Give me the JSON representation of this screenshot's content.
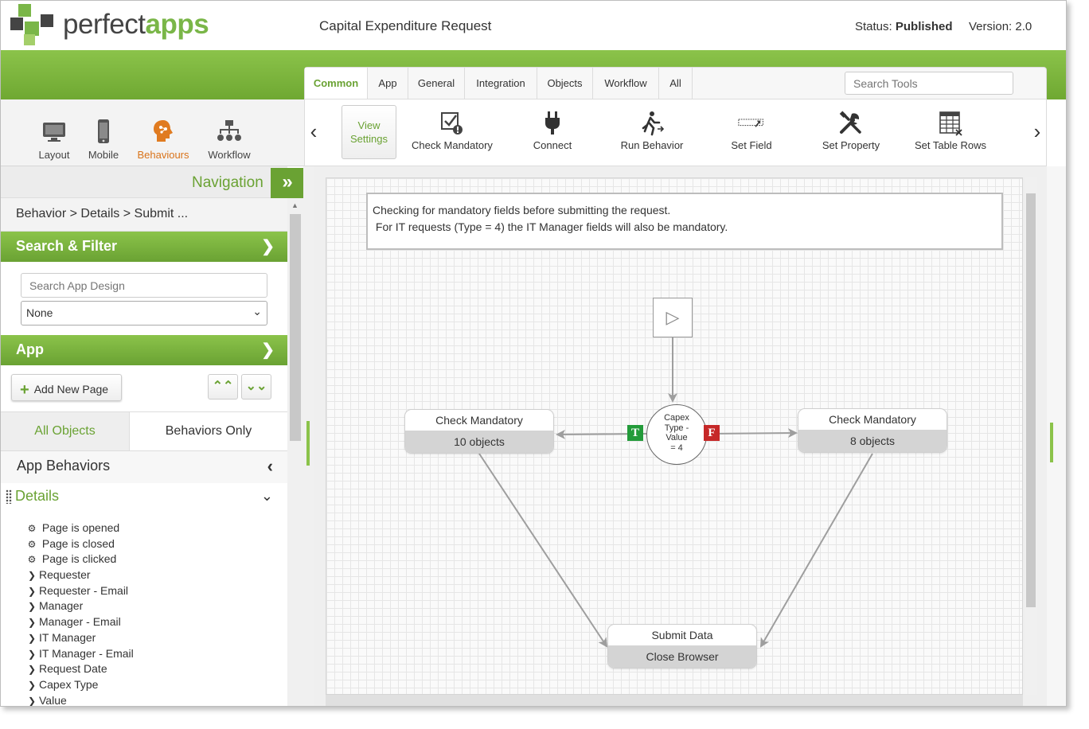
{
  "header": {
    "logo_word1": "perfect",
    "logo_word2": "apps",
    "app_title": "Capital Expenditure Request",
    "status_label": "Status:",
    "status_value": "Published",
    "version_label": "Version:",
    "version_value": "2.0"
  },
  "colors": {
    "brand_green": "#6aa233",
    "accent_orange": "#d9731a",
    "true_green": "#239b3a",
    "false_red": "#c62828"
  },
  "modes": [
    {
      "label": "Layout",
      "icon": "monitor-icon"
    },
    {
      "label": "Mobile",
      "icon": "phone-icon"
    },
    {
      "label": "Behaviours",
      "icon": "brain-icon",
      "active": true
    },
    {
      "label": "Workflow",
      "icon": "org-chart-icon"
    }
  ],
  "tabs": [
    {
      "label": "Common",
      "active": true
    },
    {
      "label": "App"
    },
    {
      "label": "General"
    },
    {
      "label": "Integration"
    },
    {
      "label": "Objects"
    },
    {
      "label": "Workflow"
    },
    {
      "label": "All"
    }
  ],
  "search_tools": {
    "placeholder": "Search Tools"
  },
  "ribbon": {
    "view_settings_line1": "View",
    "view_settings_line2": "Settings",
    "tools": [
      {
        "label": "Check Mandatory",
        "icon": "checkbox-alert-icon"
      },
      {
        "label": "Connect",
        "icon": "plug-icon"
      },
      {
        "label": "Run Behavior",
        "icon": "running-person-icon"
      },
      {
        "label": "Set Field",
        "icon": "field-edit-icon"
      },
      {
        "label": "Set Property",
        "icon": "tools-icon"
      },
      {
        "label": "Set Table Rows",
        "icon": "table-icon"
      }
    ]
  },
  "left": {
    "navigation_title": "Navigation",
    "breadcrumb": "Behavior > Details > Submit ...",
    "search_filter_title": "Search & Filter",
    "search_app_placeholder": "Search App Design",
    "filter_value": "None",
    "app_title": "App",
    "add_new_page": "Add New Page",
    "tab_all_objects": "All Objects",
    "tab_behaviors_only": "Behaviors Only",
    "app_behaviors": "App Behaviors",
    "details_title": "Details",
    "tree": [
      {
        "label": "Page is opened",
        "kind": "gear"
      },
      {
        "label": "Page is closed",
        "kind": "gear"
      },
      {
        "label": "Page is clicked",
        "kind": "gear"
      },
      {
        "label": "Requester",
        "kind": "chevron"
      },
      {
        "label": "Requester - Email",
        "kind": "chevron"
      },
      {
        "label": "Manager",
        "kind": "chevron"
      },
      {
        "label": "Manager - Email",
        "kind": "chevron"
      },
      {
        "label": "IT Manager",
        "kind": "chevron"
      },
      {
        "label": "IT Manager - Email",
        "kind": "chevron"
      },
      {
        "label": "Request Date",
        "kind": "chevron"
      },
      {
        "label": "Capex Type",
        "kind": "chevron"
      },
      {
        "label": "Value",
        "kind": "chevron"
      }
    ]
  },
  "canvas": {
    "note_line1": "Checking for mandatory fields before submitting the request.",
    "note_line2": " For IT requests (Type = 4) the IT Manager fields will also be mandatory.",
    "decision_lines": [
      "Capex",
      "Type -",
      "Value",
      "= 4"
    ],
    "true_badge": "T",
    "false_badge": "F",
    "node_left_title": "Check Mandatory",
    "node_left_sub": "10 objects",
    "node_right_title": "Check Mandatory",
    "node_right_sub": "8 objects",
    "node_bottom_title": "Submit Data",
    "node_bottom_sub": "Close Browser"
  }
}
